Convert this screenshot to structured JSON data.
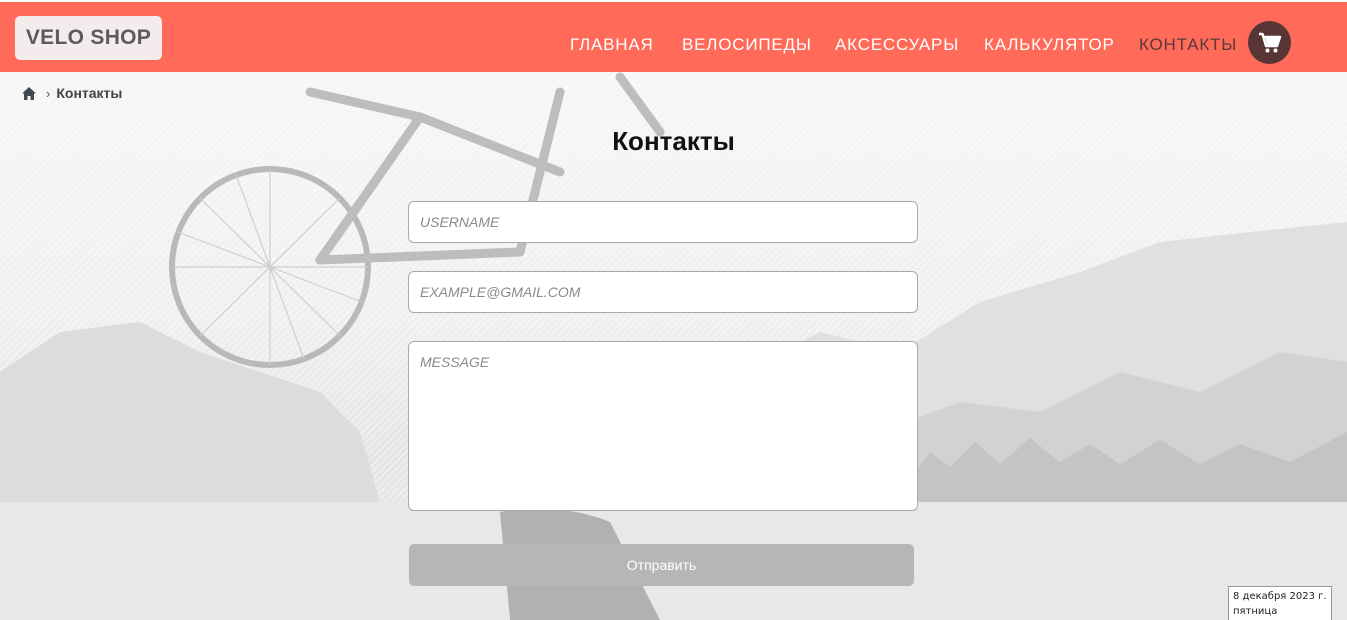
{
  "header": {
    "logo": "VELO SHOP",
    "nav": [
      "ГЛАВНАЯ",
      "ВЕЛОСИПЕДЫ",
      "АКСЕССУАРЫ",
      "КАЛЬКУЛЯТОР",
      "КОНТАКТЫ"
    ],
    "active_nav": "КОНТАКТЫ",
    "cart_icon": "shopping-cart-icon",
    "accent_color": "#ff6a59"
  },
  "breadcrumb": {
    "home_icon": "home-icon",
    "separator": "›",
    "current": "Контакты"
  },
  "page": {
    "title": "Контакты"
  },
  "form": {
    "username_placeholder": "USERNAME",
    "email_placeholder": "EXAMPLE@GMAIL.COM",
    "message_placeholder": "MESSAGE",
    "submit_label": "Отправить"
  },
  "date_widget": {
    "date": "8 декабря 2023 г.",
    "weekday": "пятница"
  }
}
